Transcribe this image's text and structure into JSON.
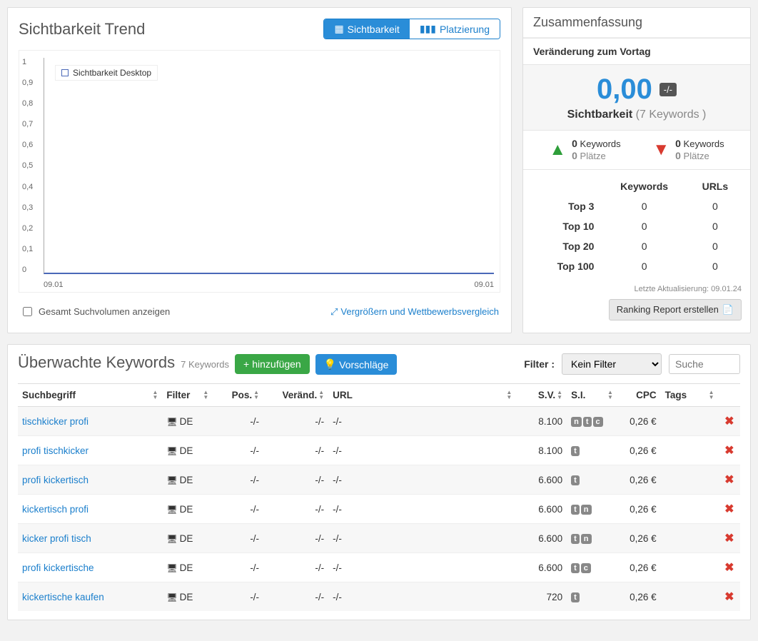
{
  "trend": {
    "title": "Sichtbarkeit Trend",
    "toggle_sichtbarkeit": "Sichtbarkeit",
    "toggle_platzierung": "Platzierung",
    "legend": "Sichtbarkeit Desktop",
    "checkbox_label": "Gesamt Suchvolumen anzeigen",
    "zoom_link": "Vergrößern und Wettbewerbsvergleich"
  },
  "chart_data": {
    "type": "line",
    "title": "Sichtbarkeit Trend",
    "xlabel": "",
    "ylabel": "",
    "ylim": [
      0,
      1
    ],
    "y_ticks": [
      "1",
      "0,9",
      "0,8",
      "0,7",
      "0,6",
      "0,5",
      "0,4",
      "0,3",
      "0,2",
      "0,1",
      "0"
    ],
    "x_ticks": [
      "09.01",
      "09.01"
    ],
    "series": [
      {
        "name": "Sichtbarkeit Desktop",
        "x": [
          "09.01",
          "09.01"
        ],
        "values": [
          0,
          0
        ]
      }
    ]
  },
  "summary": {
    "title": "Zusammenfassung",
    "change_label": "Veränderung zum Vortag",
    "big_value": "0,00",
    "badge": "-/-",
    "sicht_label": "Sichtbarkeit",
    "sicht_count": "(7 Keywords )",
    "up_keywords_num": "0",
    "up_keywords_label": "Keywords",
    "up_places_num": "0",
    "up_places_label": "Plätze",
    "down_keywords_num": "0",
    "down_keywords_label": "Keywords",
    "down_places_num": "0",
    "down_places_label": "Plätze",
    "table_header_keywords": "Keywords",
    "table_header_urls": "URLs",
    "rows": [
      {
        "label": "Top 3",
        "k": "0",
        "u": "0"
      },
      {
        "label": "Top 10",
        "k": "0",
        "u": "0"
      },
      {
        "label": "Top 20",
        "k": "0",
        "u": "0"
      },
      {
        "label": "Top 100",
        "k": "0",
        "u": "0"
      }
    ],
    "last_update": "Letzte Aktualisierung: 09.01.24",
    "report_btn": "Ranking Report erstellen"
  },
  "keywords_panel": {
    "title": "Überwachte Keywords",
    "count": "7 Keywords",
    "add_btn": "hinzufügen",
    "suggest_btn": "Vorschläge",
    "filter_label": "Filter :",
    "filter_placeholder": "Kein Filter",
    "search_placeholder": "Suche"
  },
  "kw_columns": {
    "suchbegriff": "Suchbegriff",
    "filter": "Filter",
    "pos": "Pos.",
    "verand": "Veränd.",
    "url": "URL",
    "sv": "S.V.",
    "si": "S.I.",
    "cpc": "CPC",
    "tags": "Tags"
  },
  "kw_rows": [
    {
      "term": "tischkicker profi",
      "filter": "DE",
      "pos": "-/-",
      "verand": "-/-",
      "url": "-/-",
      "sv": "8.100",
      "si": [
        "n",
        "t",
        "c"
      ],
      "cpc": "0,26 €"
    },
    {
      "term": "profi tischkicker",
      "filter": "DE",
      "pos": "-/-",
      "verand": "-/-",
      "url": "-/-",
      "sv": "8.100",
      "si": [
        "t"
      ],
      "cpc": "0,26 €"
    },
    {
      "term": "profi kickertisch",
      "filter": "DE",
      "pos": "-/-",
      "verand": "-/-",
      "url": "-/-",
      "sv": "6.600",
      "si": [
        "t"
      ],
      "cpc": "0,26 €"
    },
    {
      "term": "kickertisch profi",
      "filter": "DE",
      "pos": "-/-",
      "verand": "-/-",
      "url": "-/-",
      "sv": "6.600",
      "si": [
        "t",
        "n"
      ],
      "cpc": "0,26 €"
    },
    {
      "term": "kicker profi tisch",
      "filter": "DE",
      "pos": "-/-",
      "verand": "-/-",
      "url": "-/-",
      "sv": "6.600",
      "si": [
        "t",
        "n"
      ],
      "cpc": "0,26 €"
    },
    {
      "term": "profi kickertische",
      "filter": "DE",
      "pos": "-/-",
      "verand": "-/-",
      "url": "-/-",
      "sv": "6.600",
      "si": [
        "t",
        "c"
      ],
      "cpc": "0,26 €"
    },
    {
      "term": "kickertische kaufen",
      "filter": "DE",
      "pos": "-/-",
      "verand": "-/-",
      "url": "-/-",
      "sv": "720",
      "si": [
        "t"
      ],
      "cpc": "0,26 €"
    }
  ]
}
